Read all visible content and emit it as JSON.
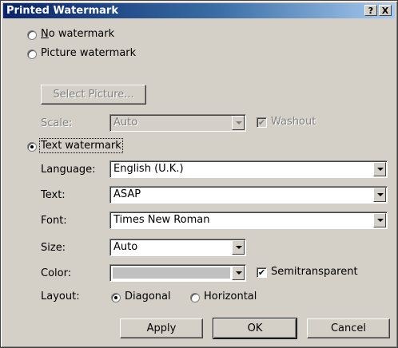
{
  "window": {
    "title": "Printed Watermark",
    "help_btn": "?",
    "close_btn": "X"
  },
  "no_watermark": {
    "label": "No watermark"
  },
  "picture_watermark": {
    "label": "Picture watermark",
    "select_picture": "Select Picture...",
    "scale_label": "Scale:",
    "scale_value": "Auto",
    "washout_label": "Washout"
  },
  "text_watermark": {
    "label": "Text watermark",
    "language_label": "Language:",
    "language_value": "English (U.K.)",
    "text_label": "Text:",
    "text_value": "ASAP",
    "font_label": "Font:",
    "font_value": "Times New Roman",
    "size_label": "Size:",
    "size_value": "Auto",
    "color_label": "Color:",
    "semitransparent_label": "Semitransparent",
    "layout_label": "Layout:",
    "diagonal_label": "Diagonal",
    "horizontal_label": "Horizontal"
  },
  "buttons": {
    "apply": "Apply",
    "ok": "OK",
    "cancel": "Cancel"
  },
  "icons": {
    "radio_selected": "filled-dot",
    "check": "✔"
  },
  "colors": {
    "titlebar_start": "#0a246a",
    "titlebar_end": "#a6caf0",
    "dialog_bg": "#d4d0c8"
  }
}
